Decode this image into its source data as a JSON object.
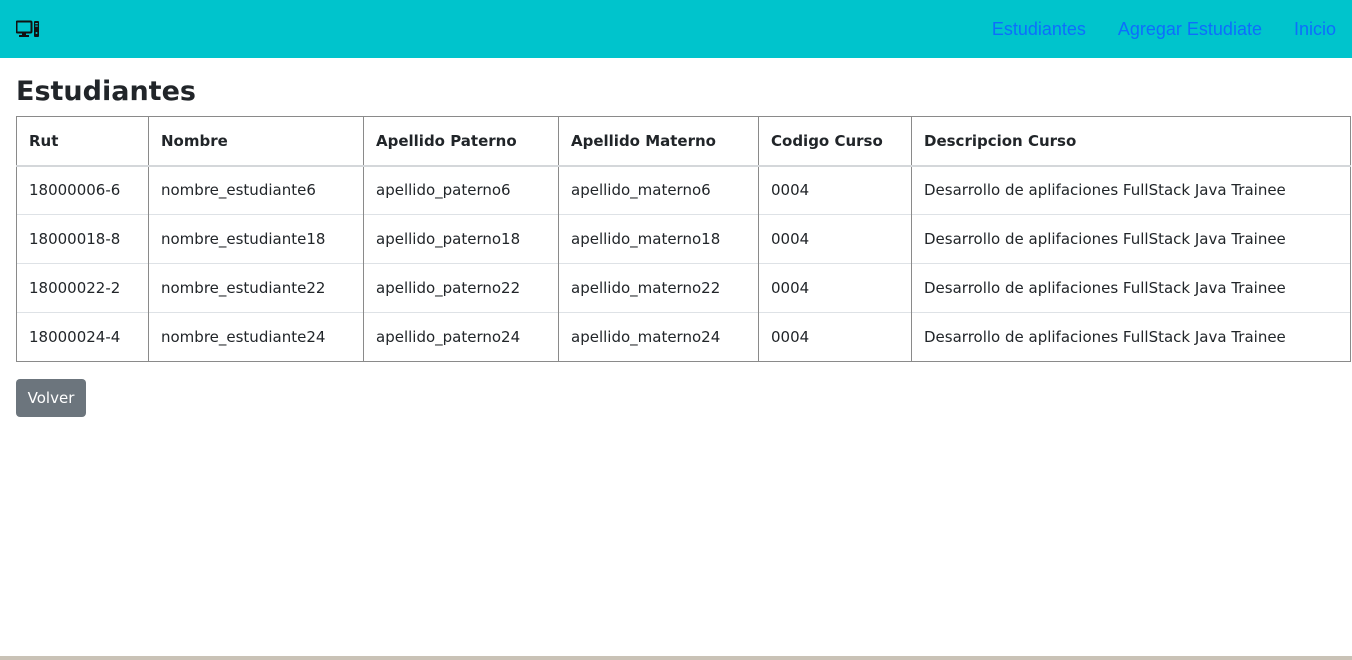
{
  "navbar": {
    "brand_icon": "desktop-computer-icon",
    "links": [
      "Estudiantes",
      "Agregar Estudiate",
      "Inicio"
    ],
    "background": "#00c4cc",
    "link_color": "#0d6efd"
  },
  "page": {
    "title": "Estudiantes"
  },
  "table": {
    "headers": [
      "Rut",
      "Nombre",
      "Apellido Paterno",
      "Apellido Materno",
      "Codigo Curso",
      "Descripcion Curso"
    ],
    "rows": [
      [
        "18000006-6",
        "nombre_estudiante6",
        "apellido_paterno6",
        "apellido_materno6",
        "0004",
        "Desarrollo de aplifaciones FullStack Java Trainee"
      ],
      [
        "18000018-8",
        "nombre_estudiante18",
        "apellido_paterno18",
        "apellido_materno18",
        "0004",
        "Desarrollo de aplifaciones FullStack Java Trainee"
      ],
      [
        "18000022-2",
        "nombre_estudiante22",
        "apellido_paterno22",
        "apellido_materno22",
        "0004",
        "Desarrollo de aplifaciones FullStack Java Trainee"
      ],
      [
        "18000024-4",
        "nombre_estudiante24",
        "apellido_paterno24",
        "apellido_materno24",
        "0004",
        "Desarrollo de aplifaciones FullStack Java Trainee"
      ]
    ]
  },
  "actions": {
    "back_label": "Volver",
    "back_color": "#6c757d"
  }
}
